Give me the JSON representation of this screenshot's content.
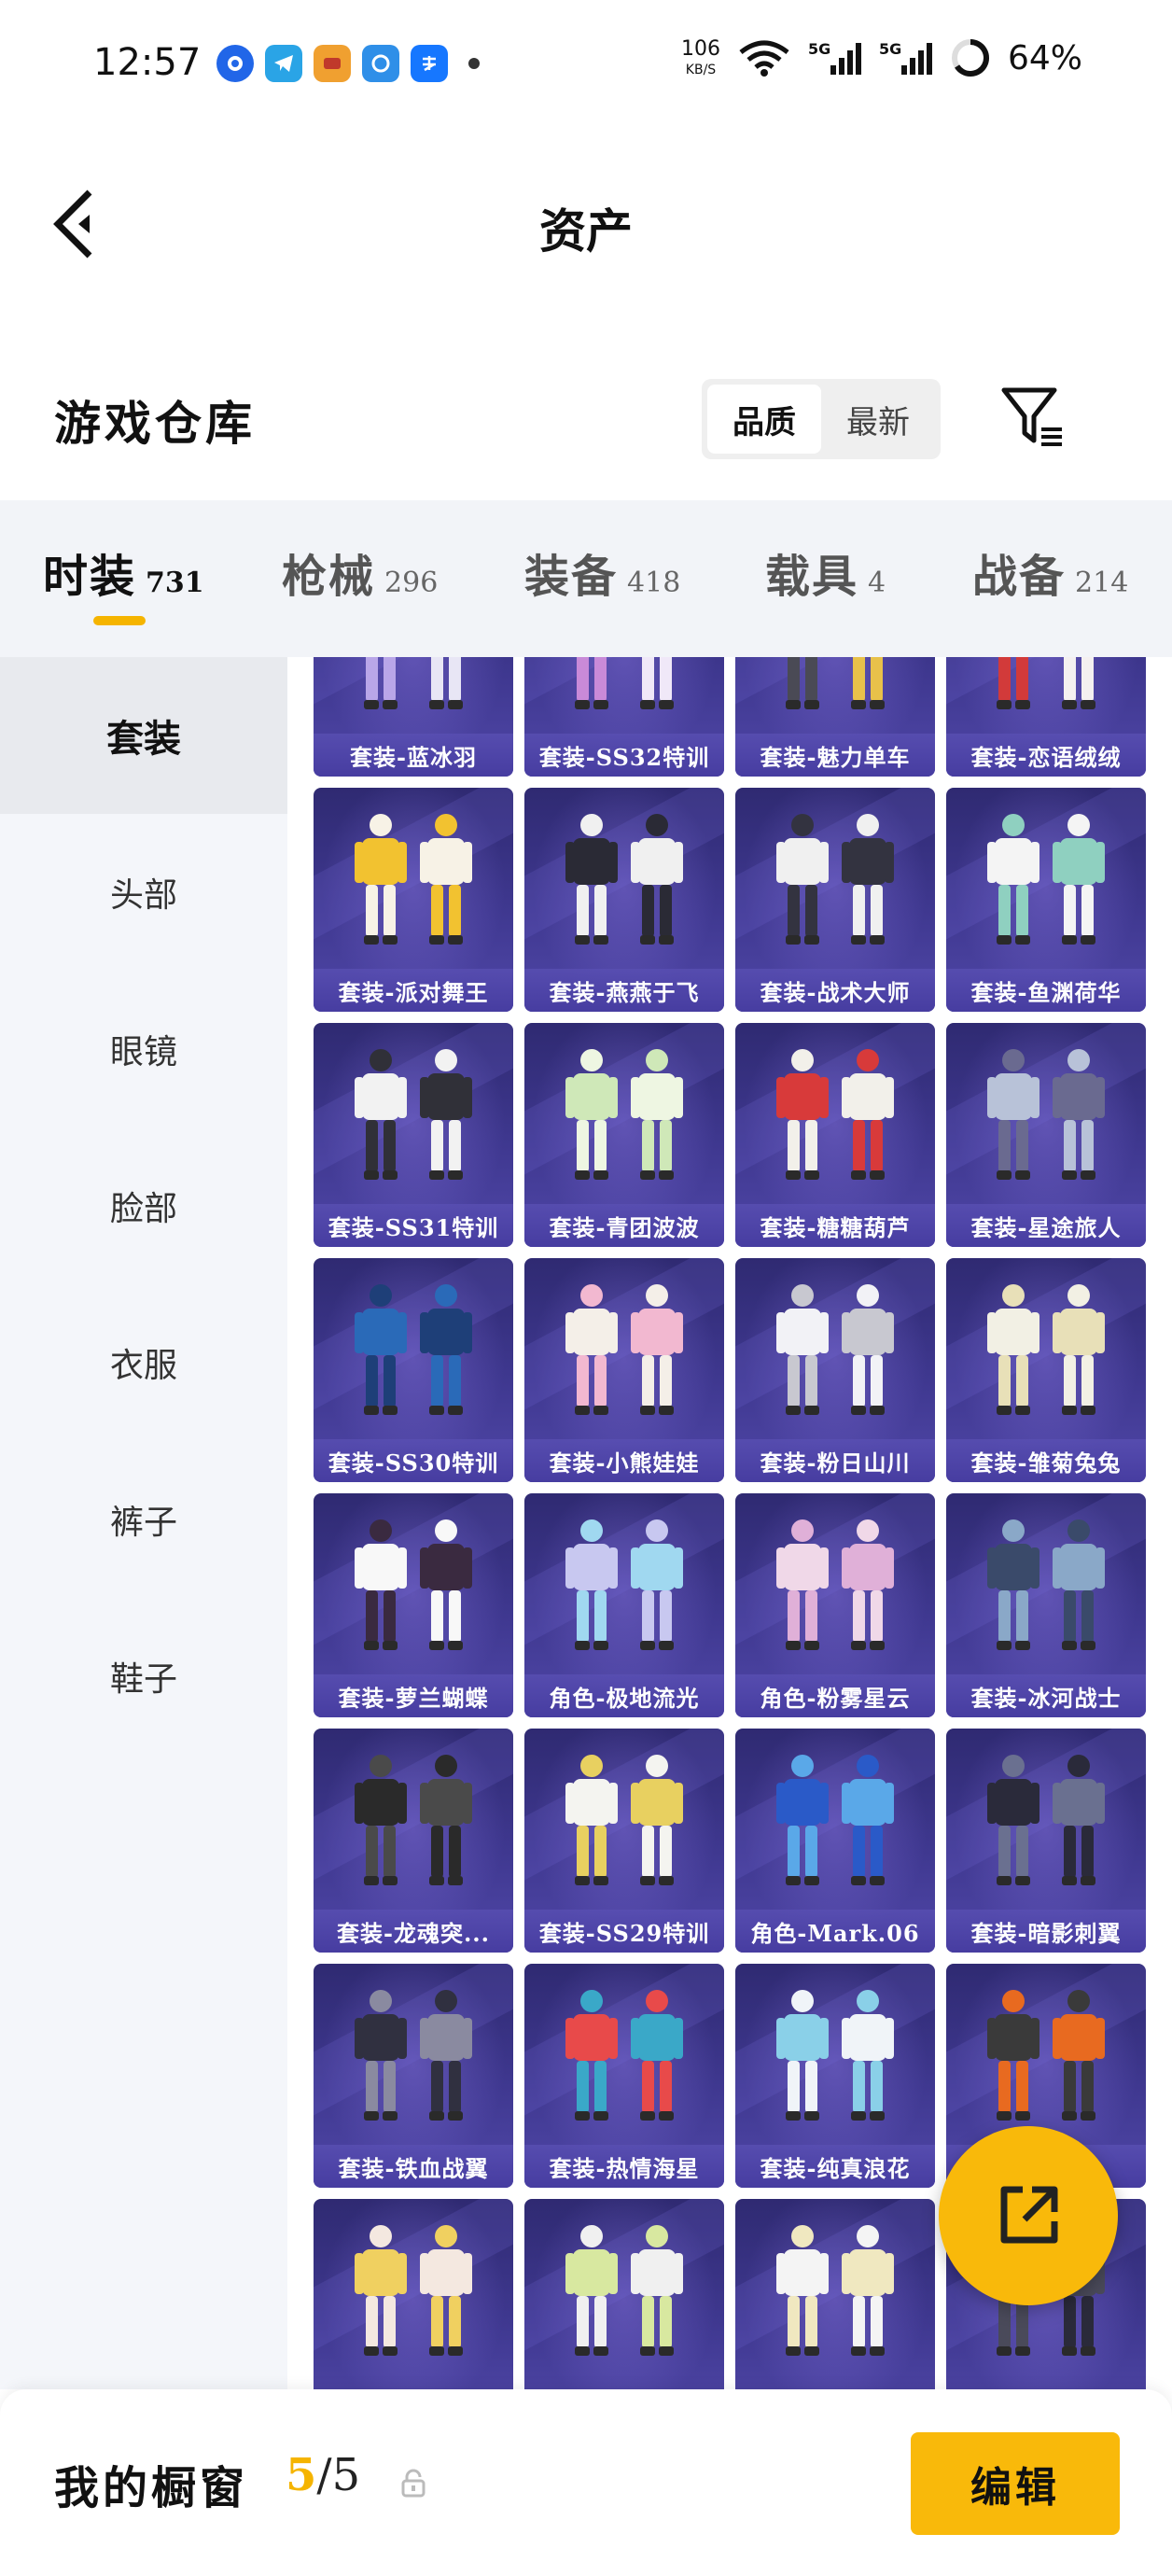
{
  "status_bar": {
    "time": "12:57",
    "net_speed": "106",
    "net_speed_unit": "KB/S",
    "battery": "64%",
    "signal_1": "5G",
    "signal_2": "5G",
    "app_icons": [
      "circle-app-icon",
      "telegram-icon",
      "game-app-icon",
      "qq-browser-icon",
      "alipay-icon"
    ]
  },
  "header": {
    "title": "资产",
    "back_icon": "chevron-left-icon"
  },
  "warehouse": {
    "title": "游戏仓库",
    "sort_options": [
      "品质",
      "最新"
    ],
    "sort_active": "品质",
    "filter_icon": "filter-icon"
  },
  "category_tabs": [
    {
      "label": "时装",
      "count": "731",
      "active": true
    },
    {
      "label": "枪械",
      "count": "296",
      "active": false
    },
    {
      "label": "装备",
      "count": "418",
      "active": false
    },
    {
      "label": "载具",
      "count": "4",
      "active": false
    },
    {
      "label": "战备",
      "count": "214",
      "active": false
    }
  ],
  "sidebar": {
    "items": [
      "套装",
      "头部",
      "眼镜",
      "脸部",
      "衣服",
      "裤子",
      "鞋子"
    ],
    "active": "套装"
  },
  "items": [
    "套装-蓝冰羽",
    "套装-SS32特训",
    "套装-魅力单车",
    "套装-恋语绒绒",
    "套装-派对舞王",
    "套装-燕燕于飞",
    "套装-战术大师",
    "套装-鱼渊荷华",
    "套装-SS31特训",
    "套装-青团波波",
    "套装-糖糖葫芦",
    "套装-星途旅人",
    "套装-SS30特训",
    "套装-小熊娃娃",
    "套装-粉日山川",
    "套装-雏菊兔兔",
    "套装-萝兰蝴蝶",
    "角色-极地流光",
    "角色-粉雾星云",
    "套装-冰河战士",
    "套装-龙魂突...",
    "套装-SS29特训",
    "角色-Mark.06",
    "套装-暗影刺翼",
    "套装-铁血战翼",
    "套装-热情海星",
    "套装-纯真浪花",
    "...",
    "",
    "",
    "",
    ""
  ],
  "fab": {
    "icon": "share-external-icon"
  },
  "bottom_bar": {
    "label": "我的橱窗",
    "current": "5",
    "separator": "/",
    "max": "5",
    "lock_icon": "lock-icon",
    "edit_label": "编辑"
  },
  "colors": {
    "accent": "#f9b90a",
    "tile_bg": "#3f3890",
    "sidebar_bg": "#f4f6fa"
  }
}
